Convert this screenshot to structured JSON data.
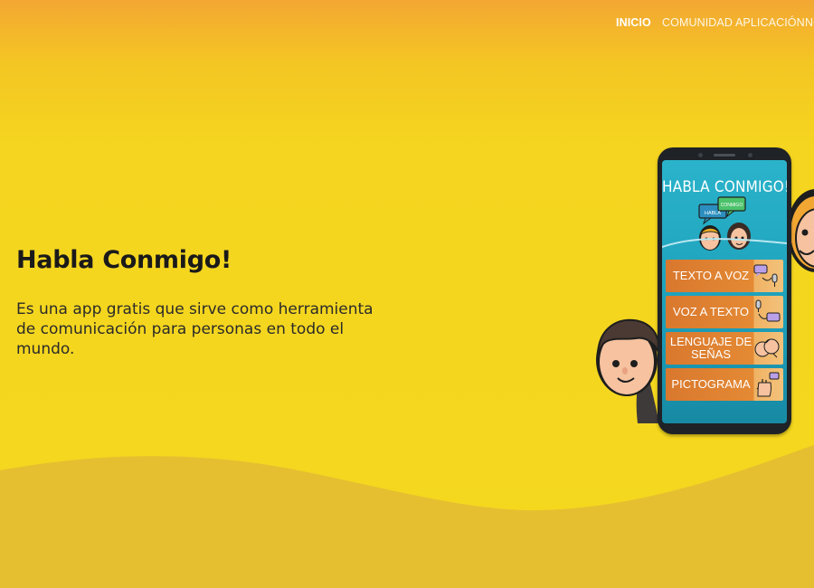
{
  "nav": {
    "items": [
      {
        "label": "INICIO",
        "active": true
      },
      {
        "label": "COMUNIDAD",
        "active": false
      },
      {
        "label": "APLICACIÓN",
        "active": false
      },
      {
        "label": "NO",
        "active": false
      }
    ]
  },
  "hero": {
    "title": "Habla Conmigo!",
    "subtitle": "Es una app gratis que sirve como herramienta de comunicación para personas en todo el mundo."
  },
  "phone": {
    "app_title": "HABLA CONMIGO!",
    "logo_bubbles": [
      "HABLA",
      "CONMIGO"
    ],
    "menu": [
      {
        "label": "TEXTO A VOZ",
        "icon": "speech-to-mic-icon"
      },
      {
        "label": "VOZ A TEXTO",
        "icon": "mic-to-speech-icon"
      },
      {
        "label": "LENGUAJE DE SEÑAS",
        "icon": "sign-hands-icon"
      },
      {
        "label": "PICTOGRAMA",
        "icon": "hand-pictogram-icon"
      }
    ]
  },
  "colors": {
    "background_top": "#f3a733",
    "background": "#f4d81e",
    "wave": "#e8c030",
    "phone_screen": "#22a9c3",
    "menu_button": "#e08233"
  }
}
